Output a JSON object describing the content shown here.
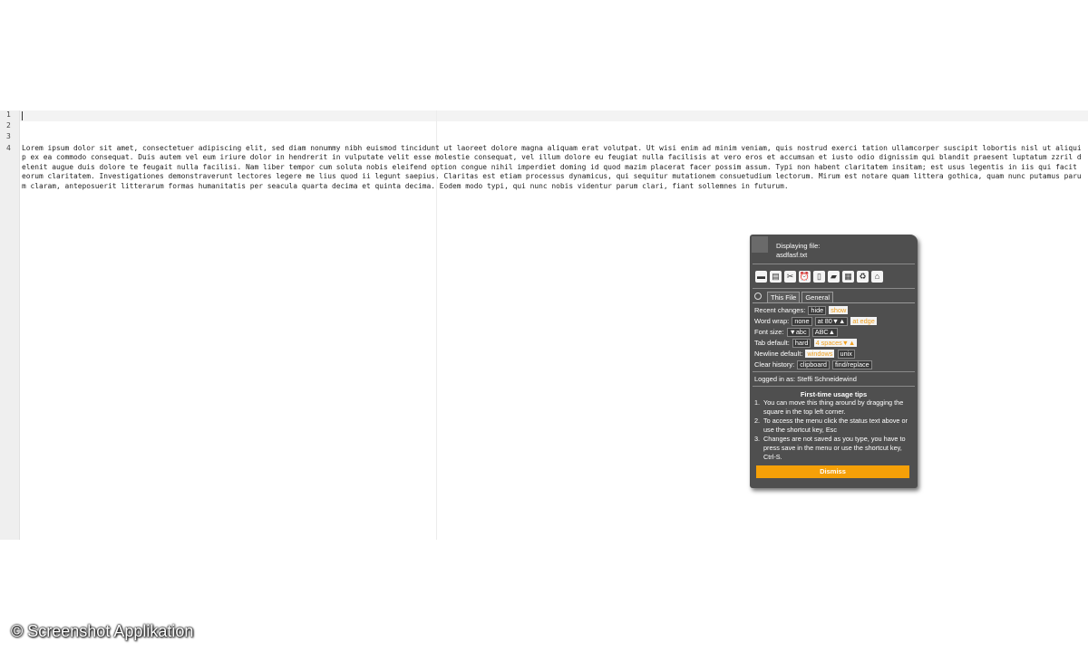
{
  "editor": {
    "line_numbers": [
      "1",
      "2",
      "3",
      "4"
    ],
    "line4_text": "Lorem ipsum dolor sit amet, consectetuer adipiscing elit, sed diam nonummy nibh euismod tincidunt ut laoreet dolore magna aliquam erat volutpat. Ut wisi enim ad minim veniam, quis nostrud exerci tation ullamcorper suscipit lobortis nisl ut aliquip ex ea commodo consequat. Duis autem vel eum iriure dolor in hendrerit in vulputate velit esse molestie consequat, vel illum dolore eu feugiat nulla facilisis at vero eros et accumsan et iusto odio dignissim qui blandit praesent luptatum zzril delenit augue duis dolore te feugait nulla facilisi. Nam liber tempor cum soluta nobis eleifend option congue nihil imperdiet doming id quod mazim placerat facer possim assum. Typi non habent claritatem insitam; est usus legentis in iis qui facit eorum claritatem. Investigationes demonstraverunt lectores legere me lius quod ii legunt saepius. Claritas est etiam processus dynamicus, qui sequitur mutationem consuetudium lectorum. Mirum est notare quam littera gothica, quam nunc putamus parum claram, anteposuerit litterarum formas humanitatis per seacula quarta decima et quinta decima. Eodem modo typi, qui nunc nobis videntur parum clari, fiant sollemnes in futurum."
  },
  "panel": {
    "status_line1": "Displaying file:",
    "status_line2": "asdfasf.txt",
    "toolbar_icons": [
      "save-icon",
      "print-icon",
      "tools-icon",
      "alarm-icon",
      "document-icon",
      "folder-open-icon",
      "keyboard-icon",
      "recycle-icon",
      "home-icon"
    ],
    "toolbar_glyphs": [
      "▬",
      "▤",
      "✂",
      "⏰",
      "▯",
      "▰",
      "▦",
      "♻",
      "⌂"
    ],
    "tabs": {
      "this_file": "This File",
      "general": "General"
    },
    "settings": {
      "recent_label": "Recent changes:",
      "recent_hide": "hide",
      "recent_show": "show",
      "wrap_label": "Word wrap:",
      "wrap_none": "none",
      "wrap_at80": "at 80▼▲",
      "wrap_edge": "at edge",
      "font_label": "Font size:",
      "font_smaller": "▼abc",
      "font_larger": "ABC▲",
      "tab_label": "Tab default:",
      "tab_hard": "hard",
      "tab_spaces": "4 spaces▼▲",
      "newline_label": "Newline default:",
      "newline_windows": "windows",
      "newline_unix": "unix",
      "clear_label": "Clear history:",
      "clear_clipboard": "clipboard",
      "clear_find": "find/replace"
    },
    "logged_in": "Logged in as: Steffi Schneidewind",
    "tips_title": "First-time usage tips",
    "tips": [
      {
        "n": "1.",
        "text": "You can move this thing around by dragging the square in the top left corner."
      },
      {
        "n": "2.",
        "text": "To access the menu click the status text above or use the shortcut key, Esc"
      },
      {
        "n": "3.",
        "text": "Changes are not saved as you type, you have to press save in the menu or use the shortcut key, Ctrl-S."
      }
    ],
    "dismiss": "Dismiss"
  },
  "watermark": "© Screenshot Applikation",
  "colors": {
    "accent": "#f5a008",
    "panel_bg": "#4f4f4f",
    "gutter_bg": "#efefef"
  }
}
